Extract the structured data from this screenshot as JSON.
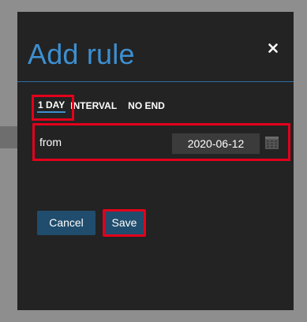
{
  "dialog": {
    "title": "Add rule",
    "close_icon": "close-icon"
  },
  "tabs": [
    {
      "label": "1 DAY",
      "active": true
    },
    {
      "label": "INTERVAL",
      "active": false
    },
    {
      "label": "NO END",
      "active": false
    }
  ],
  "range": {
    "from_label": "from",
    "from_value": "2020-06-12",
    "calendar_icon": "calendar-icon"
  },
  "actions": {
    "cancel_label": "Cancel",
    "save_label": "Save"
  },
  "colors": {
    "accent": "#3d8fd1",
    "button": "#204d6d",
    "highlight": "#e3001b",
    "dialog_bg": "#232323"
  }
}
